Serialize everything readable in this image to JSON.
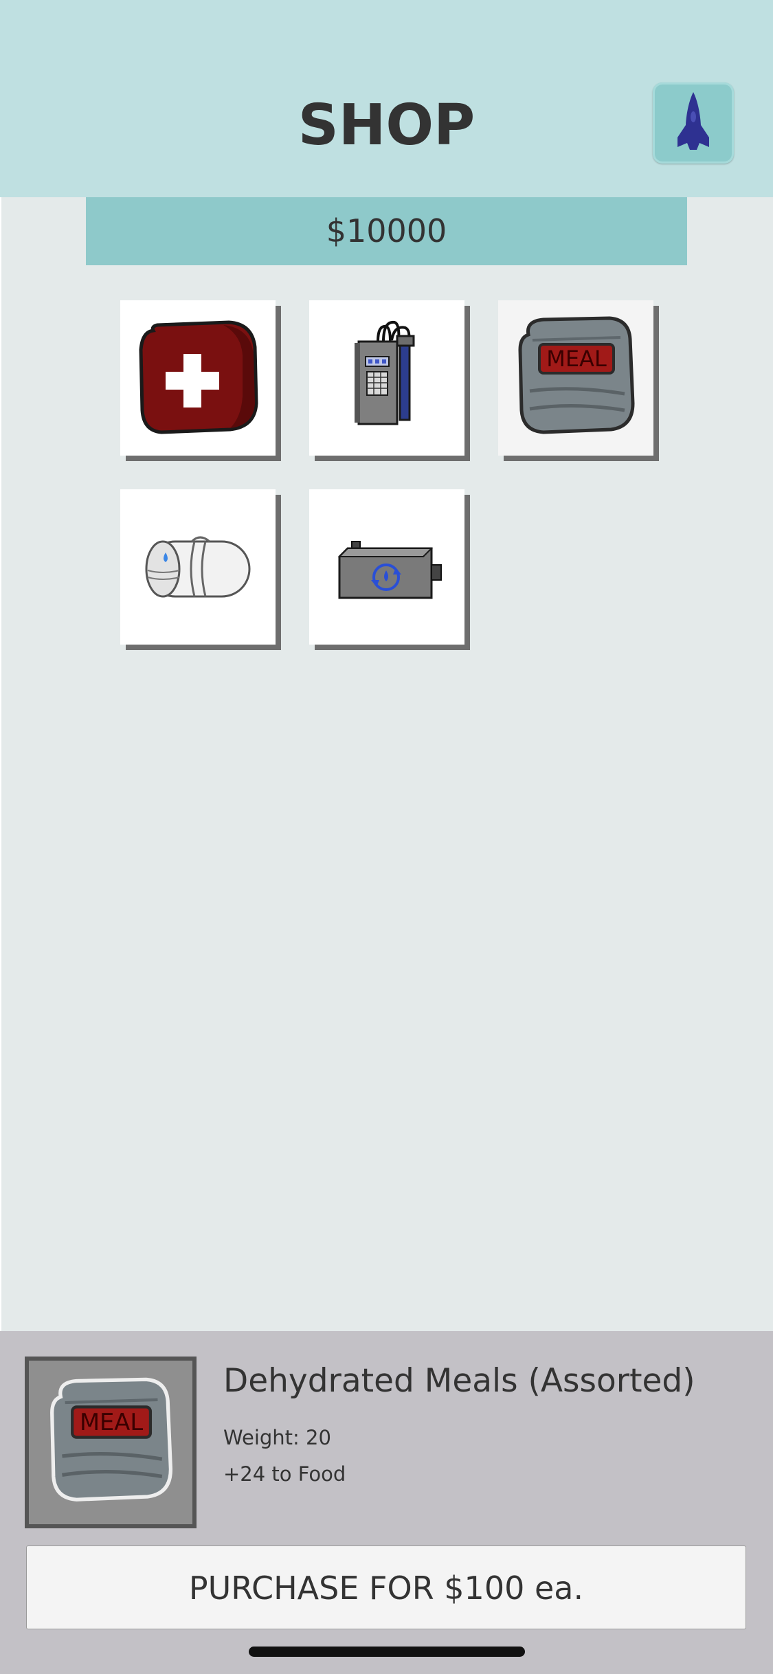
{
  "header": {
    "title": "SHOP",
    "ship_button_icon": "rocket-icon"
  },
  "money": {
    "balance": "$10000"
  },
  "items": [
    {
      "icon": "first-aid-kit-icon",
      "selected": false
    },
    {
      "icon": "water-filter-device-icon",
      "selected": false
    },
    {
      "icon": "meal-pack-icon",
      "selected": true
    },
    {
      "icon": "sleeping-bag-icon",
      "selected": false
    },
    {
      "icon": "water-recycler-icon",
      "selected": false
    }
  ],
  "details": {
    "icon": "meal-pack-icon",
    "name": "Dehydrated Meals (Assorted)",
    "weight": "Weight: 20",
    "effect": "+24 to Food",
    "meal_label": "MEAL"
  },
  "purchase": {
    "label": "PURCHASE FOR $100 ea."
  },
  "colors": {
    "header_bg": "#bfe0e1",
    "money_bar_bg": "#8ec9ca",
    "page_bg": "#e4eaea",
    "details_bg": "#c3c1c6",
    "rocket": "#2e3191"
  }
}
